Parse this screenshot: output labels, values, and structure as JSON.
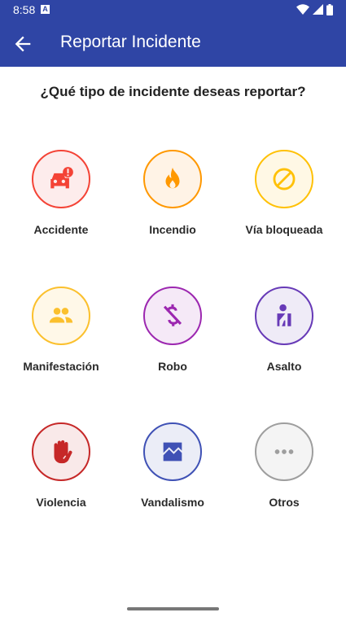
{
  "status_bar": {
    "time": "8:58",
    "notification_icon": "A",
    "icons": [
      "wifi-icon",
      "signal-icon",
      "battery-icon"
    ]
  },
  "app_bar": {
    "title": "Reportar Incidente",
    "back_icon": "arrow-back-icon",
    "color": "#2f45a5"
  },
  "question": "¿Qué tipo de incidente deseas reportar?",
  "incidents": [
    {
      "label": "Accidente",
      "icon": "car-crash-icon",
      "color": "#f44336",
      "bg": "#fdecec"
    },
    {
      "label": "Incendio",
      "icon": "fire-icon",
      "color": "#ff9800",
      "bg": "#fff3e6"
    },
    {
      "label": "Vía bloqueada",
      "icon": "block-icon",
      "color": "#ffc107",
      "bg": "#fff8e5"
    },
    {
      "label": "Manifestación",
      "icon": "people-icon",
      "color": "#fbc02d",
      "bg": "#fff8e8"
    },
    {
      "label": "Robo",
      "icon": "money-off-icon",
      "color": "#9c27b0",
      "bg": "#f5e9f7"
    },
    {
      "label": "Asalto",
      "icon": "person-injured-icon",
      "color": "#673ab7",
      "bg": "#efebf7"
    },
    {
      "label": "Violencia",
      "icon": "hand-stop-icon",
      "color": "#c62828",
      "bg": "#f9e9e9"
    },
    {
      "label": "Vandalismo",
      "icon": "broken-image-icon",
      "color": "#3f51b5",
      "bg": "#ebedf7"
    },
    {
      "label": "Otros",
      "icon": "more-horiz-icon",
      "color": "#9e9e9e",
      "bg": "#f4f4f4"
    }
  ]
}
